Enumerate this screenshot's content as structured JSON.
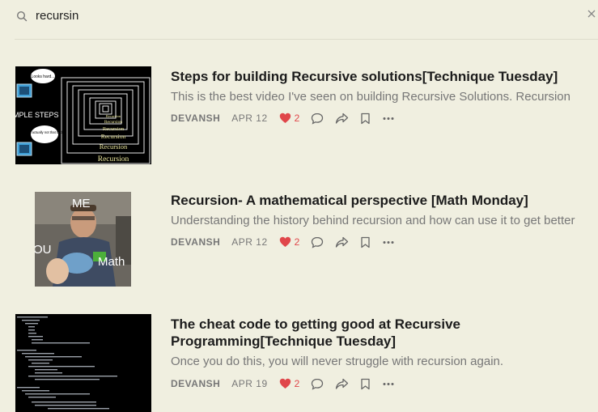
{
  "search": {
    "query": "recursin",
    "search_icon": "search-icon",
    "clear_icon": "close-icon"
  },
  "colors": {
    "background": "#f0efe0",
    "like": "#e0464a",
    "muted": "#777777"
  },
  "posts": [
    {
      "title": "Steps for building Recursive solutions[Technique Tuesday]",
      "subtitle": "This is the best video I've seen on building Recursive Solutions. Recursion",
      "author": "DEVANSH",
      "date": "APR 12",
      "likes": "2",
      "thumbnail": {
        "bubble_1": "Looks hard...",
        "bubble_2": "It's actually not that bad",
        "side_label": "MPLE STEPS",
        "stack_labels": [
          "Recursion",
          "Recursion",
          "Recursion",
          "Recursion",
          "Recursion",
          "Recursion"
        ]
      }
    },
    {
      "title": "Recursion- A mathematical perspective [Math Monday]",
      "subtitle": "Understanding the history behind recursion and how can use it to get better",
      "author": "DEVANSH",
      "date": "APR 12",
      "likes": "2",
      "thumbnail": {
        "label_me": "ME",
        "label_you": "YOU",
        "label_math": "Math"
      }
    },
    {
      "title_line1": "The cheat code to getting good at Recursive",
      "title_line2": "Programming[Technique Tuesday]",
      "subtitle": "Once you do this, you will never struggle with recursion again.",
      "author": "DEVANSH",
      "date": "APR 19",
      "likes": "2"
    }
  ],
  "action_icons": [
    "heart-icon",
    "comment-icon",
    "share-icon",
    "bookmark-icon",
    "more-icon"
  ]
}
